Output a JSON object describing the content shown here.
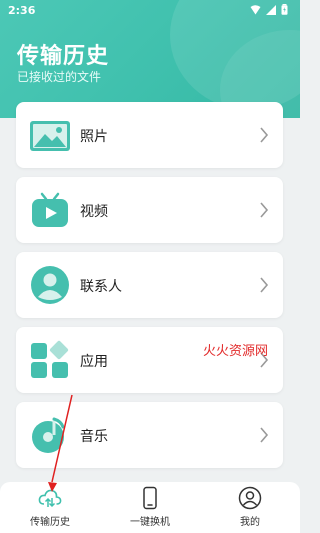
{
  "status": {
    "time": "2:36"
  },
  "header": {
    "title": "传输历史",
    "subtitle": "已接收过的文件"
  },
  "items": [
    {
      "label": "照片",
      "icon": "image-icon"
    },
    {
      "label": "视频",
      "icon": "tv-play-icon"
    },
    {
      "label": "联系人",
      "icon": "contact-person-icon"
    },
    {
      "label": "应用",
      "icon": "app-grid-icon"
    },
    {
      "label": "音乐",
      "icon": "music-disc-icon"
    }
  ],
  "watermark": "火火资源网",
  "tabbar": {
    "tabs": [
      {
        "label": "传输历史",
        "icon": "cloud-transfer-icon",
        "active": true
      },
      {
        "label": "一键换机",
        "icon": "phone-icon",
        "active": false
      },
      {
        "label": "我的",
        "icon": "user-circle-icon",
        "active": false
      }
    ]
  },
  "colors": {
    "accent": "#3fc0ad",
    "icon_teal": "#45bfae",
    "watermark": "#e22a2a",
    "annotation_arrow": "#e02020"
  }
}
